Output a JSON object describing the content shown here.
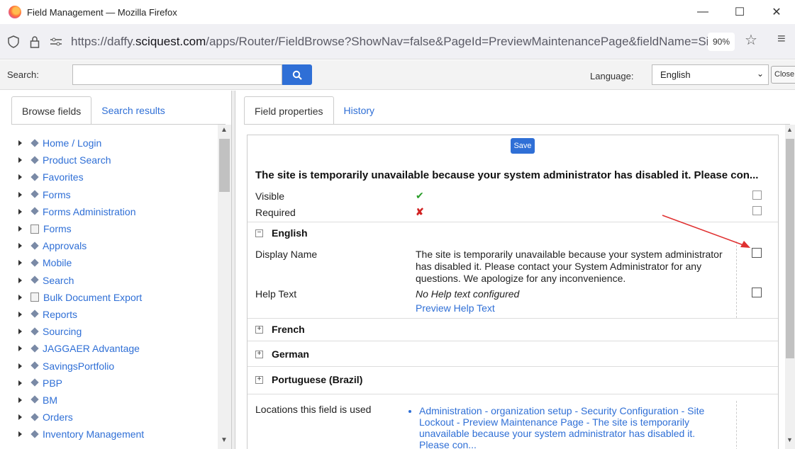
{
  "window": {
    "title": "Field Management — Mozilla Firefox",
    "controls": [
      "—",
      "☐",
      "✕"
    ]
  },
  "urlbar": {
    "url_prefix": "https://daffy.",
    "url_domain": "sciquest.com",
    "url_path": "/apps/Router/FieldBrowse?ShowNav=false&PageId=PreviewMaintenancePage&fieldName=Site",
    "zoom": "90%"
  },
  "toolbar": {
    "search_label": "Search:",
    "search_value": "",
    "language_label": "Language:",
    "language_value": "English",
    "close_label": "Close"
  },
  "left": {
    "tabs": [
      {
        "label": "Browse fields",
        "active": true
      },
      {
        "label": "Search results",
        "active": false
      }
    ],
    "tree": [
      {
        "label": "Home / Login",
        "icon": "diamond"
      },
      {
        "label": "Product Search",
        "icon": "diamond"
      },
      {
        "label": "Favorites",
        "icon": "diamond"
      },
      {
        "label": "Forms",
        "icon": "diamond"
      },
      {
        "label": "Forms Administration",
        "icon": "diamond"
      },
      {
        "label": "Forms",
        "icon": "doc"
      },
      {
        "label": "Approvals",
        "icon": "diamond"
      },
      {
        "label": "Mobile",
        "icon": "diamond"
      },
      {
        "label": "Search",
        "icon": "diamond"
      },
      {
        "label": "Bulk Document Export",
        "icon": "doc"
      },
      {
        "label": "Reports",
        "icon": "diamond"
      },
      {
        "label": "Sourcing",
        "icon": "diamond"
      },
      {
        "label": "JAGGAER Advantage",
        "icon": "diamond"
      },
      {
        "label": "SavingsPortfolio",
        "icon": "diamond"
      },
      {
        "label": "PBP",
        "icon": "diamond"
      },
      {
        "label": "BM",
        "icon": "diamond"
      },
      {
        "label": "Orders",
        "icon": "diamond"
      },
      {
        "label": "Inventory Management",
        "icon": "diamond"
      }
    ]
  },
  "right": {
    "tabs": [
      {
        "label": "Field properties",
        "active": true
      },
      {
        "label": "History",
        "active": false
      }
    ],
    "save_label": "Save",
    "heading": "The site is temporarily unavailable because your system administrator has disabled it. Please con...",
    "visible_label": "Visible",
    "visible_mark": "✔",
    "required_label": "Required",
    "required_mark": "✘",
    "english": {
      "title": "English",
      "display_name_label": "Display Name",
      "display_name_value": "The site is temporarily unavailable because your system administrator has disabled it. Please contact your System Administrator for any questions. We apologize for any inconvenience.",
      "help_text_label": "Help Text",
      "help_text_value": "No Help text configured",
      "preview_help_link": "Preview Help Text"
    },
    "sections": {
      "french": "French",
      "german": "German",
      "portuguese": "Portuguese (Brazil)"
    },
    "locations_label": "Locations this field is used",
    "locations": [
      "Administration - organization setup - Security Configuration - Site Lockout - Preview Maintenance Page - The site is temporarily unavailable because your system administrator has disabled it. Please con..."
    ]
  },
  "colors": {
    "accent": "#2f6fd6",
    "check": "#2a9d2a",
    "cross": "#d12222",
    "annotation_arrow": "#e03030"
  }
}
